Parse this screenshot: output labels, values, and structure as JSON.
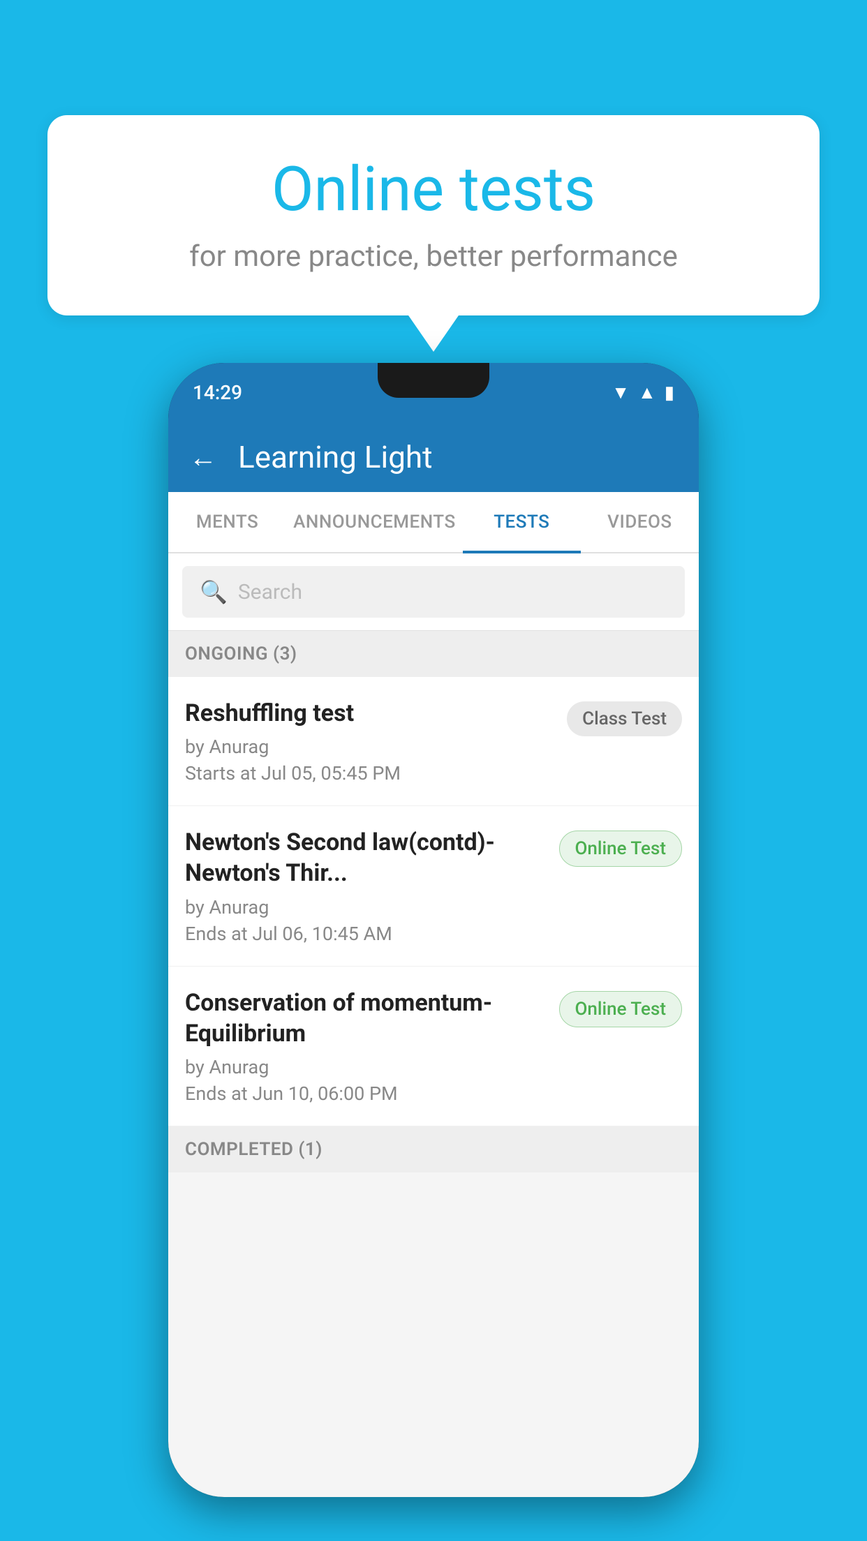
{
  "background_color": "#1ab8e8",
  "bubble": {
    "title": "Online tests",
    "subtitle": "for more practice, better performance"
  },
  "phone": {
    "status_bar": {
      "time": "14:29",
      "icons": [
        "wifi",
        "signal",
        "battery"
      ]
    },
    "header": {
      "back_label": "←",
      "title": "Learning Light"
    },
    "tabs": [
      {
        "label": "MENTS",
        "active": false
      },
      {
        "label": "ANNOUNCEMENTS",
        "active": false
      },
      {
        "label": "TESTS",
        "active": true
      },
      {
        "label": "VIDEOS",
        "active": false
      }
    ],
    "search": {
      "placeholder": "Search"
    },
    "sections": [
      {
        "header": "ONGOING (3)",
        "items": [
          {
            "name": "Reshuffling test",
            "by": "by Anurag",
            "date": "Starts at  Jul 05, 05:45 PM",
            "badge": "Class Test",
            "badge_type": "class"
          },
          {
            "name": "Newton's Second law(contd)-Newton's Thir...",
            "by": "by Anurag",
            "date": "Ends at  Jul 06, 10:45 AM",
            "badge": "Online Test",
            "badge_type": "online"
          },
          {
            "name": "Conservation of momentum-Equilibrium",
            "by": "by Anurag",
            "date": "Ends at  Jun 10, 06:00 PM",
            "badge": "Online Test",
            "badge_type": "online"
          }
        ]
      },
      {
        "header": "COMPLETED (1)",
        "items": []
      }
    ]
  }
}
